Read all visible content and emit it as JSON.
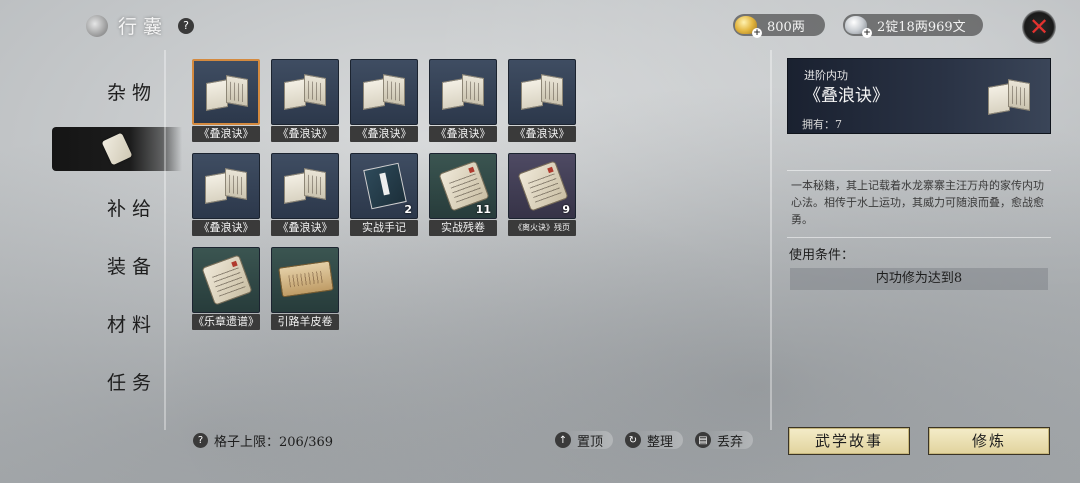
{
  "header": {
    "title": "行囊",
    "help_glyph": "?"
  },
  "currency": {
    "gold": "800两",
    "silver": "2锭18两969文",
    "plus_glyph": "+"
  },
  "close_glyph": "✕",
  "nav": {
    "items": [
      {
        "label": "杂物"
      },
      {
        "label": ""
      },
      {
        "label": "补给"
      },
      {
        "label": "装备"
      },
      {
        "label": "材料"
      },
      {
        "label": "任务"
      }
    ]
  },
  "inventory": {
    "items": [
      {
        "label": "《叠浪诀》",
        "count": "",
        "kind": "book",
        "bg": "blue",
        "selected": true
      },
      {
        "label": "《叠浪诀》",
        "count": "",
        "kind": "book",
        "bg": "blue",
        "selected": false
      },
      {
        "label": "《叠浪诀》",
        "count": "",
        "kind": "book",
        "bg": "blue",
        "selected": false
      },
      {
        "label": "《叠浪诀》",
        "count": "",
        "kind": "book",
        "bg": "blue",
        "selected": false
      },
      {
        "label": "《叠浪诀》",
        "count": "",
        "kind": "book",
        "bg": "blue",
        "selected": false
      },
      {
        "label": "《叠浪诀》",
        "count": "",
        "kind": "book",
        "bg": "blue",
        "selected": false
      },
      {
        "label": "《叠浪诀》",
        "count": "",
        "kind": "book",
        "bg": "blue",
        "selected": false
      },
      {
        "label": "实战手记",
        "count": "2",
        "kind": "manual",
        "bg": "blue",
        "selected": false
      },
      {
        "label": "实战残卷",
        "count": "11",
        "kind": "scroll",
        "bg": "green",
        "selected": false
      },
      {
        "label": "《离火诀》残页",
        "count": "9",
        "kind": "scroll",
        "bg": "purple",
        "selected": false
      },
      {
        "label": "《乐章遗谱》",
        "count": "",
        "kind": "scroll",
        "bg": "green",
        "selected": false
      },
      {
        "label": "引路羊皮卷",
        "count": "",
        "kind": "parchment",
        "bg": "green",
        "selected": false
      }
    ]
  },
  "footer": {
    "capacity_label": "格子上限：206/369",
    "actions": [
      {
        "label": "置顶",
        "glyph": "↑"
      },
      {
        "label": "整理",
        "glyph": "↻"
      },
      {
        "label": "丢弃",
        "glyph": "▤"
      }
    ]
  },
  "detail": {
    "type": "进阶内功",
    "name": "《叠浪诀》",
    "owned": "拥有：7",
    "description": "一本秘籍，其上记载着水龙寨寨主汪万舟的家传内功心法。相传于水上运功，其威力可随浪而叠，愈战愈勇。",
    "condition_title": "使用条件：",
    "condition": "内功修为达到8",
    "button_story": "武学故事",
    "button_train": "修炼"
  }
}
